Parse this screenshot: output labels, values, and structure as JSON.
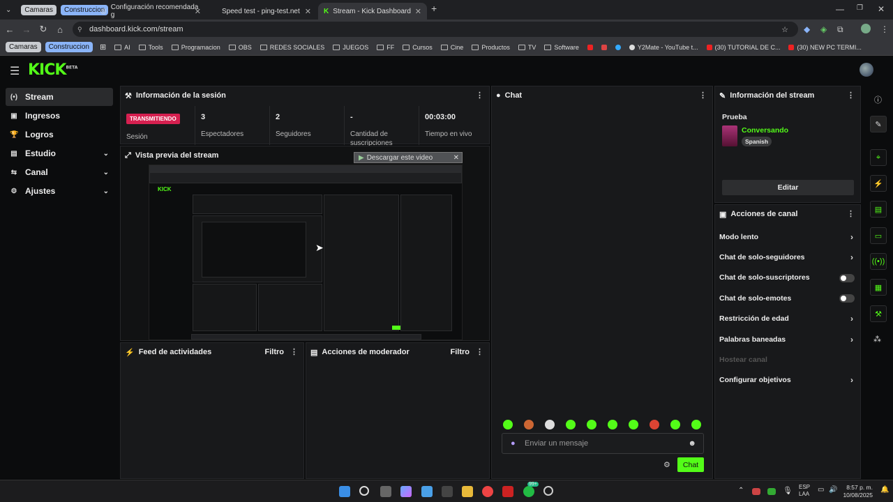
{
  "browser": {
    "groups": [
      "Camaras",
      "Construccion"
    ],
    "tabs": [
      "Configuración recomendada g",
      "Speed test - ping-test.net",
      "Stream - Kick Dashboard"
    ],
    "new_tab": "+",
    "url": "dashboard.kick.com/stream",
    "bookmark_groups": [
      "Camaras",
      "Construccion"
    ],
    "bookmarks": [
      "AI",
      "Tools",
      "Programacion",
      "OBS",
      "REDES SOCIALES",
      "JUEGOS",
      "FF",
      "Cursos",
      "Cine",
      "Productos",
      "TV",
      "Software",
      "Y2Mate - YouTube t...",
      "(30) TUTORIAL DE C...",
      "(30) NEW PC TERMI..."
    ]
  },
  "app": {
    "logo": "KICK",
    "logo_badge": "BETA",
    "sidebar": [
      {
        "label": "Stream",
        "icon": "(•)",
        "active": true
      },
      {
        "label": "Ingresos",
        "icon": "▣"
      },
      {
        "label": "Logros",
        "icon": "🏆"
      },
      {
        "label": "Estudio",
        "icon": "▤",
        "chevron": "⌄"
      },
      {
        "label": "Canal",
        "icon": "⇆",
        "chevron": "⌄"
      },
      {
        "label": "Ajustes",
        "icon": "⚙",
        "chevron": "⌄"
      }
    ],
    "session": {
      "title": "Información de la sesión",
      "badge": "TRANSMITIENDO",
      "badge_label": "Sesión",
      "stats": [
        {
          "value": "3",
          "label": "Espectadores"
        },
        {
          "value": "2",
          "label": "Seguidores"
        },
        {
          "value": "-",
          "label": "Cantidad de suscripciones"
        },
        {
          "value": "00:03:00",
          "label": "Tiempo en vivo"
        }
      ]
    },
    "preview": {
      "title": "Vista previa del stream",
      "download": "Descargar este video"
    },
    "feed": {
      "title": "Feed de actividades",
      "filter": "Filtro"
    },
    "mod": {
      "title": "Acciones de moderador",
      "filter": "Filtro"
    },
    "chat": {
      "title": "Chat",
      "placeholder": "Enviar un mensaje",
      "button": "Chat"
    },
    "stream_info": {
      "title": "Información del stream",
      "stream_title": "Prueba",
      "category": "Conversando",
      "language": "Spanish",
      "edit": "Editar"
    },
    "channel_actions": {
      "title": "Acciones de canal",
      "items": [
        {
          "label": "Modo lento",
          "type": "chevron"
        },
        {
          "label": "Chat de solo-seguidores",
          "type": "chevron"
        },
        {
          "label": "Chat de solo-suscriptores",
          "type": "toggle"
        },
        {
          "label": "Chat de solo-emotes",
          "type": "toggle"
        },
        {
          "label": "Restricción de edad",
          "type": "chevron"
        },
        {
          "label": "Palabras baneadas",
          "type": "chevron"
        },
        {
          "label": "Hostear canal",
          "type": "disabled"
        },
        {
          "label": "Configurar objetivos",
          "type": "chevron"
        }
      ]
    }
  },
  "taskbar": {
    "lang": "ESP",
    "lang2": "LAA",
    "time": "8:57 p. m.",
    "date": "10/08/2025",
    "badge": "99+"
  },
  "colors": {
    "accent": "#53fc18",
    "live": "#d62050"
  }
}
